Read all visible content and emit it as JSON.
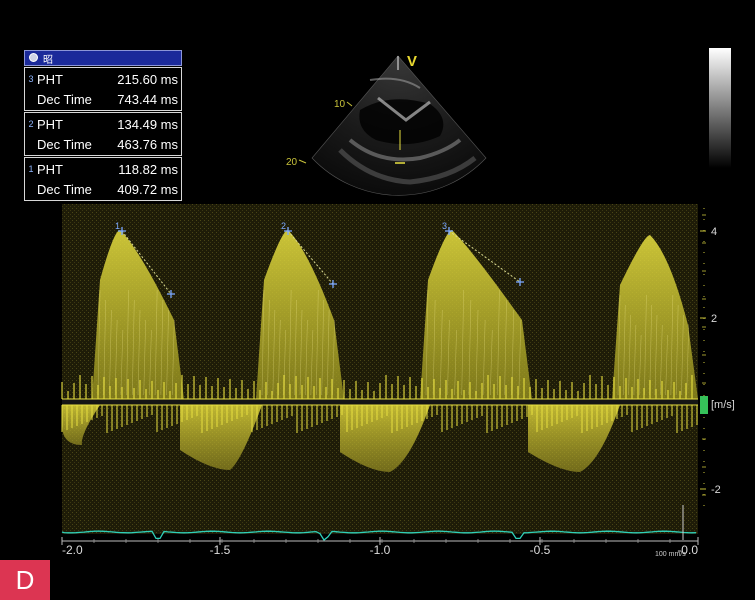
{
  "panel_label": "D",
  "measurements": {
    "header": "昭",
    "groups": [
      {
        "index": "3",
        "rows": [
          {
            "name": "PHT",
            "value": "215.60 ms"
          },
          {
            "name": "Dec Time",
            "value": "743.44 ms"
          }
        ]
      },
      {
        "index": "2",
        "rows": [
          {
            "name": "PHT",
            "value": "134.49 ms"
          },
          {
            "name": "Dec Time",
            "value": "463.76 ms"
          }
        ]
      },
      {
        "index": "1",
        "rows": [
          {
            "name": "PHT",
            "value": "118.82 ms"
          },
          {
            "name": "Dec Time",
            "value": "409.72 ms"
          }
        ]
      }
    ]
  },
  "sector_image": {
    "marker": "V",
    "depth_labels": [
      "10",
      "20"
    ]
  },
  "doppler": {
    "unit_label": "[m/s]",
    "velocity_ticks": [
      "4",
      "2",
      "-2"
    ],
    "time_ticks": [
      "-2.0",
      "-1.5",
      "-1.0",
      "-0.5",
      "-0.0"
    ],
    "sweep_label": "100 mm/s",
    "trace_markers": [
      "1",
      "2",
      "3"
    ],
    "colors": {
      "spectrum": "#e8e040",
      "ecg": "#2fd0b8",
      "cursor": "#7aa8ff",
      "scale": "#c8c23a",
      "marker": "#36c25a"
    }
  }
}
